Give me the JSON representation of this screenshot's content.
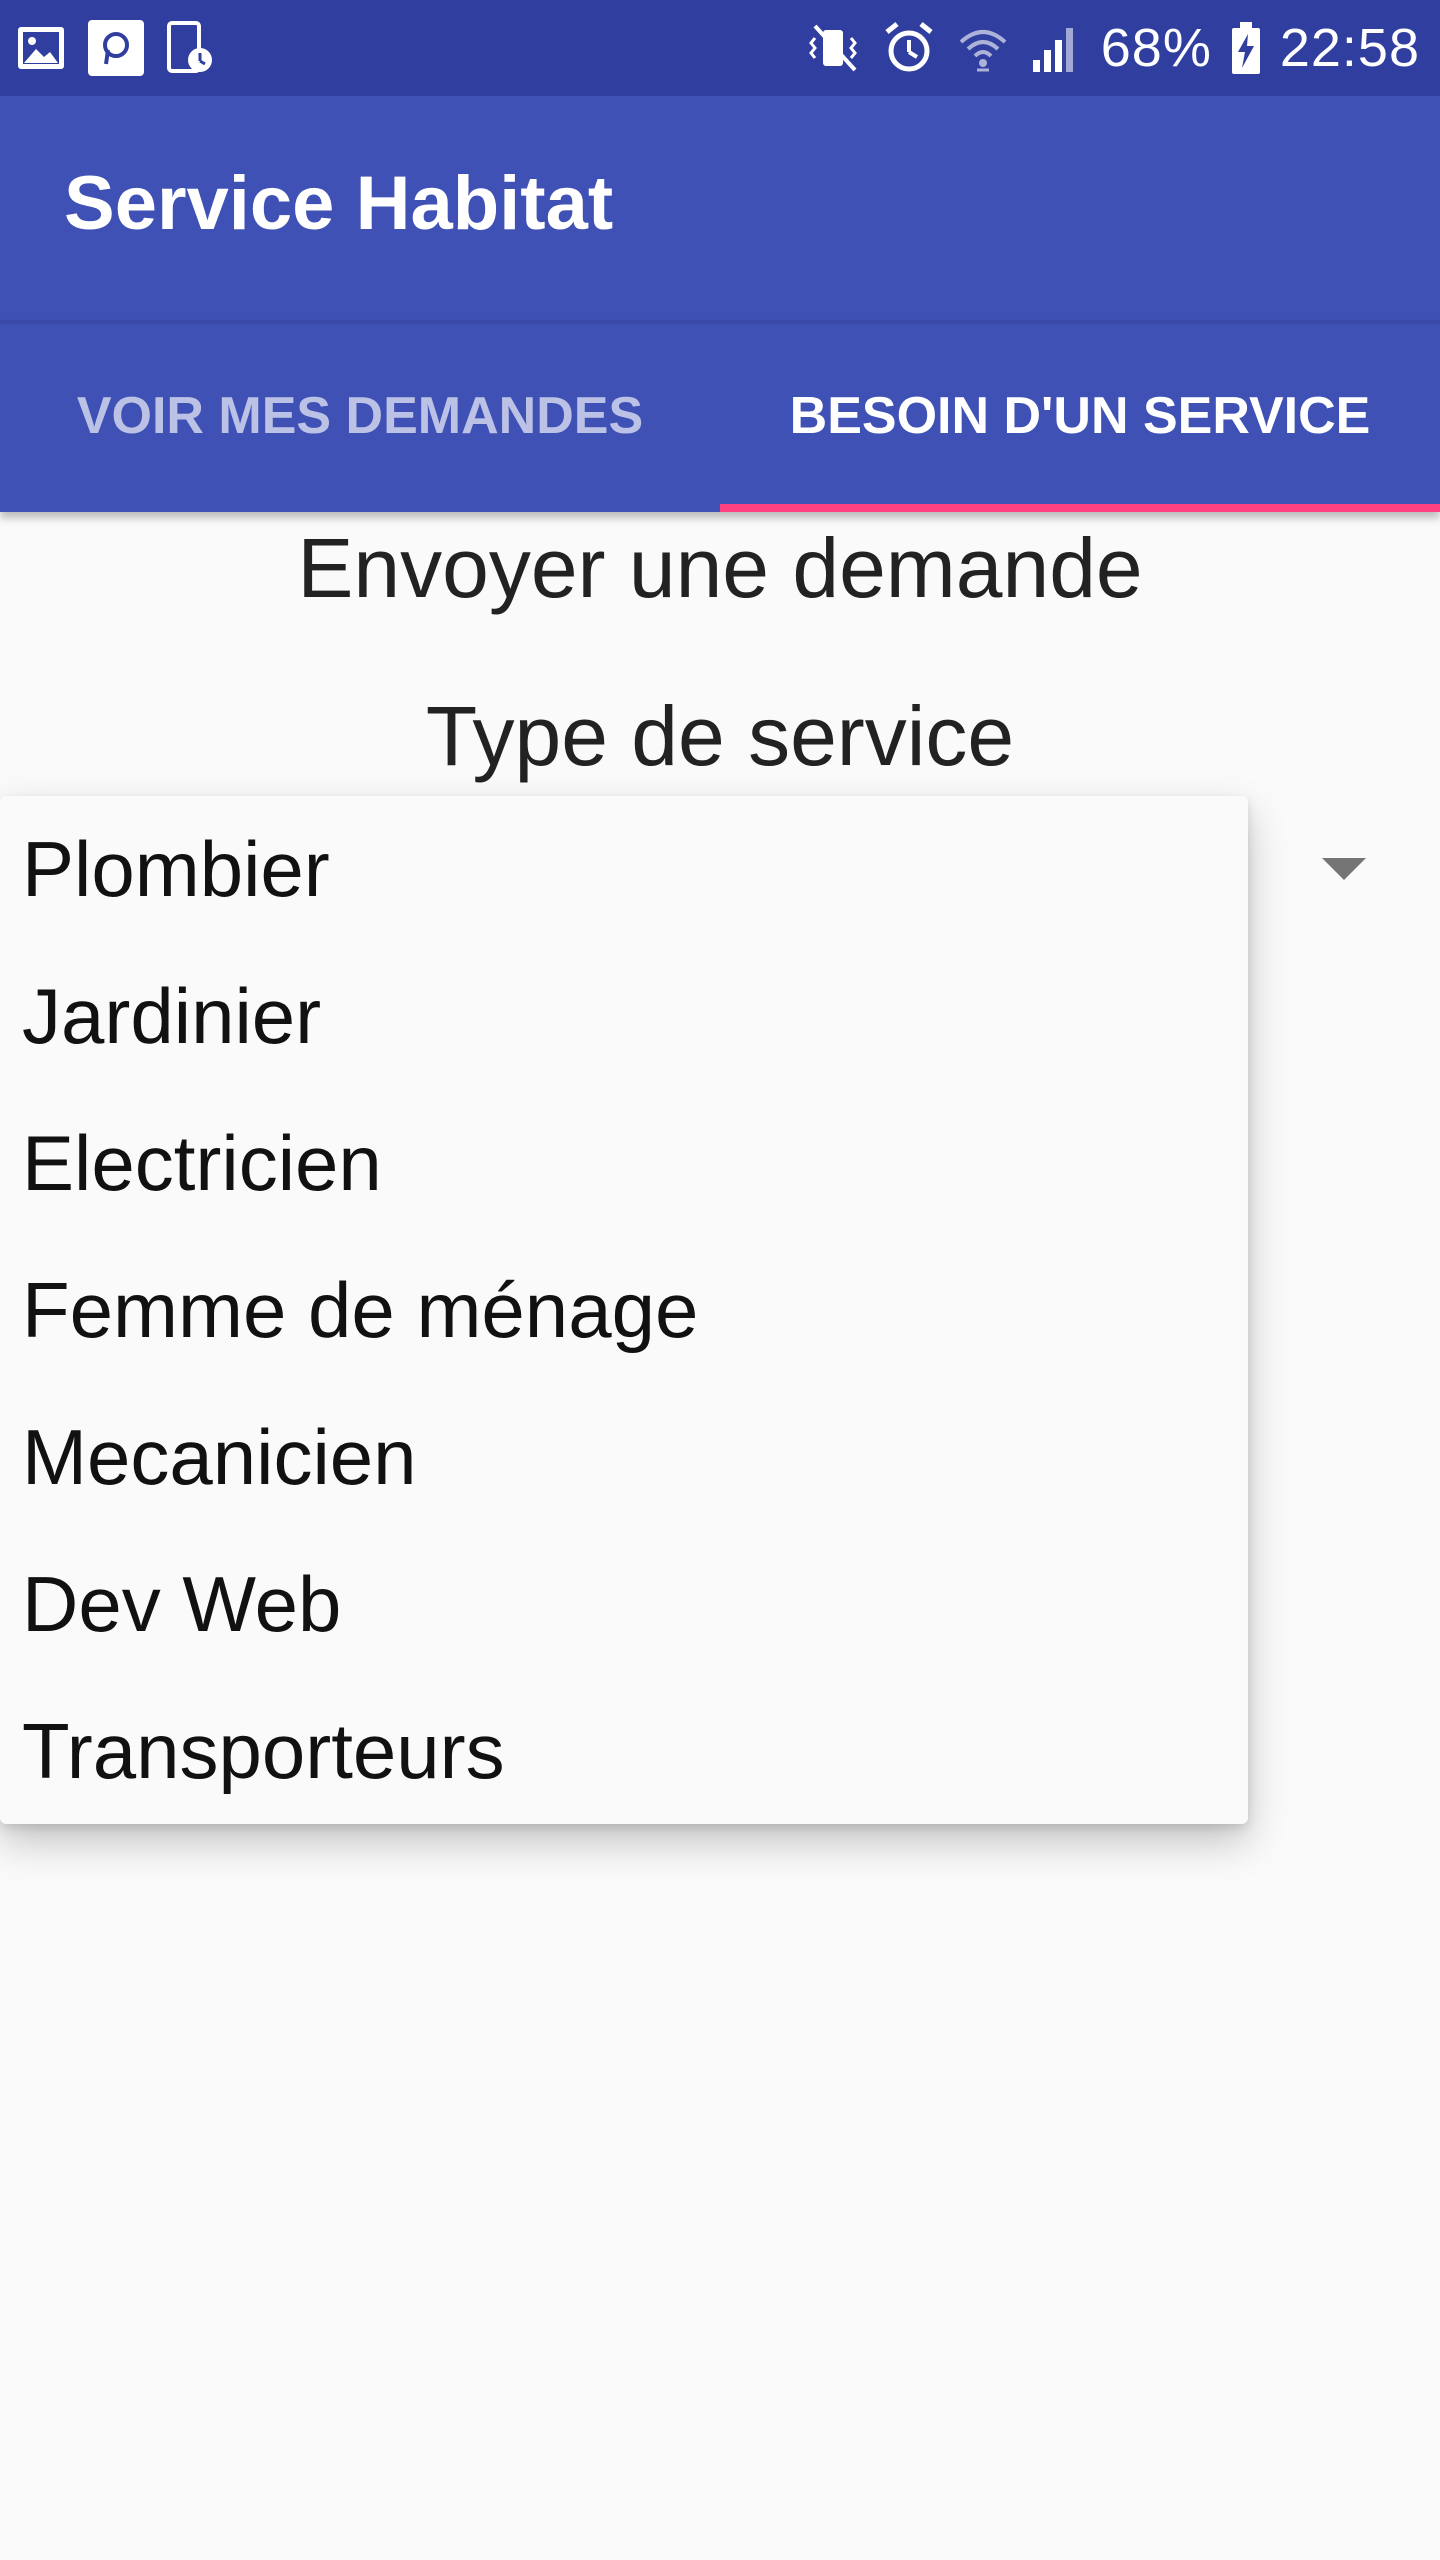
{
  "status_bar": {
    "battery": "68%",
    "time": "22:58",
    "left_icons": [
      "gallery-icon",
      "app-p-icon",
      "screen-time-icon"
    ],
    "right_icons": [
      "vibrate-mute-icon",
      "alarm-icon",
      "wifi-icon",
      "signal-icon",
      "battery-charging-icon"
    ]
  },
  "app_bar": {
    "title": "Service Habitat"
  },
  "tabs": [
    {
      "label": "VOIR MES DEMANDES",
      "selected": false
    },
    {
      "label": "BESOIN D'UN SERVICE",
      "selected": true
    }
  ],
  "main": {
    "heading": "Envoyer une demande",
    "service_label": "Type de service",
    "dropdown_items": [
      "Plombier",
      "Jardinier",
      "Electricien",
      "Femme de ménage",
      "Mecanicien",
      "Dev Web",
      "Transporteurs"
    ]
  },
  "colors": {
    "status_bar": "#303f9f",
    "primary": "#3f51b5",
    "accent": "#ff4081",
    "background": "#fafafa"
  }
}
